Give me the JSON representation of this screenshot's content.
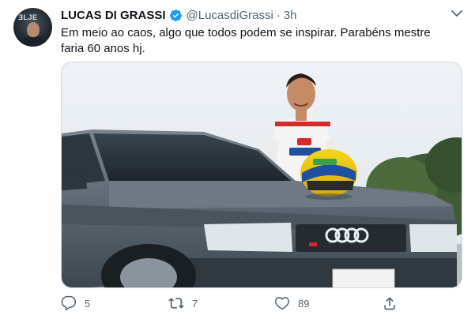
{
  "tweet": {
    "author": {
      "display_name": "LUCAS DI GRASSI",
      "handle": "@LucasdiGrassi",
      "separator": "·",
      "time": "3h",
      "avatar_badge": "ƎLJE"
    },
    "text_lines": [
      "Em meio ao caos, algo que todos podem se inspirar. Parabéns mestre",
      "faria 60 anos hj."
    ],
    "actions": {
      "reply_count": "5",
      "retweet_count": "7",
      "like_count": "89"
    }
  },
  "icons": {
    "verified": "verified-badge-icon",
    "menu": "chevron-down-icon",
    "reply": "reply-icon",
    "retweet": "retweet-icon",
    "like": "heart-icon",
    "share": "share-icon"
  },
  "colors": {
    "verified": "#1d9bf0",
    "secondary_text": "#536471",
    "primary_text": "#0f1419",
    "car_body": "#5b6670"
  }
}
